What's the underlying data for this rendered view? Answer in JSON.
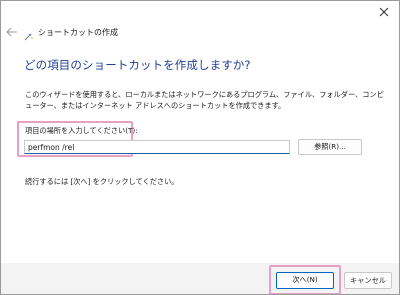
{
  "window": {
    "title": "ショートカットの作成",
    "close_icon": "close-icon",
    "back_icon": "back-arrow-icon",
    "wizard_icon": "shortcut-wizard-icon"
  },
  "main": {
    "heading": "どの項目のショートカットを作成しますか?",
    "description": "このウィザードを使用すると、ローカルまたはネットワークにあるプログラム、ファイル、フォルダー、コンピューター、またはインターネット アドレスへのショートカットを作成できます。",
    "location_label": "項目の場所を入力してください(T):",
    "location_value": "perfmon /rel",
    "browse_label": "参照(R)...",
    "instruction": "続行するには [次へ] をクリックしてください。"
  },
  "footer": {
    "next_label": "次へ(N)",
    "cancel_label": "キャンセル"
  },
  "colors": {
    "heading": "#1f3f99",
    "highlight": "#e8a0c5",
    "accent": "#0067c0"
  }
}
